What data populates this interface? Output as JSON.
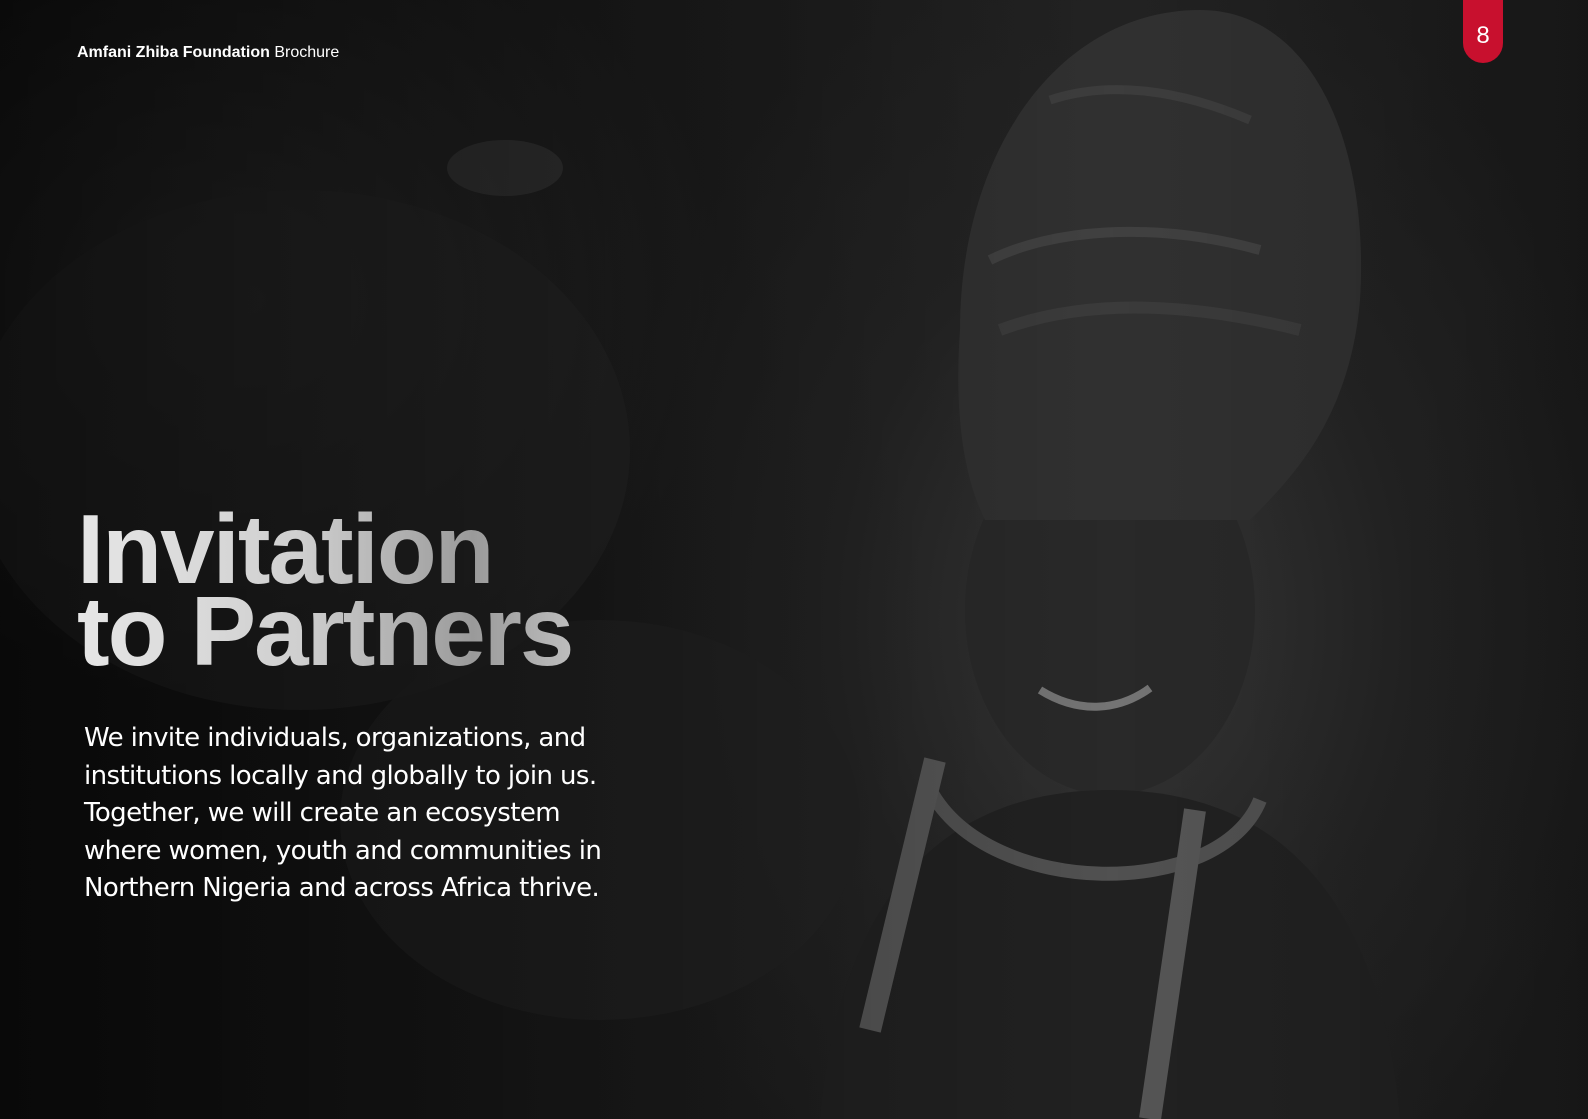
{
  "header": {
    "org_name": "Amfani Zhiba Foundation",
    "doc_type": "Brochure"
  },
  "page_number": "8",
  "title": {
    "line1": "Invitation",
    "line2": "to Partners"
  },
  "body": "We invite individuals, organizations, and institutions locally and globally to join us. Together, we will create an ecosystem where women, youth and communities in Northern Nigeria and across Africa thrive.",
  "colors": {
    "accent": "#c8102e",
    "background": "#1a1a1a",
    "text": "#ffffff"
  },
  "image": {
    "subject": "background-photo"
  }
}
